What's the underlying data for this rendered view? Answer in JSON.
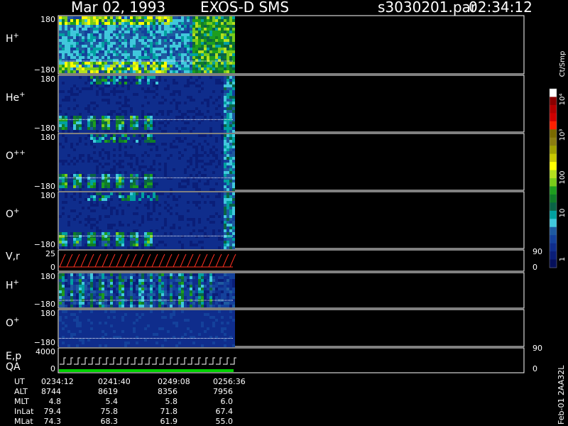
{
  "header": {
    "date": "Mar 02, 1993",
    "instrument": "EXOS-D SMS",
    "file": "s3030201.par",
    "time": "02:34:12"
  },
  "colorbar": {
    "unit": "Ct/Smp",
    "ticks": [
      "10⁴",
      "10³",
      "100",
      "10",
      "1"
    ],
    "colors": [
      "#ffffff",
      "#8b0000",
      "#b40000",
      "#d10000",
      "#ff2000",
      "#7a6a00",
      "#8b7d10",
      "#a0a000",
      "#c8c800",
      "#ffff00",
      "#b4e01e",
      "#7acc19",
      "#1e9e1e",
      "#0f7d28",
      "#0a6446",
      "#00a0a0",
      "#40c8dc",
      "#1e5aa0",
      "#14419b",
      "#0f2d8c",
      "#0a1e78",
      "#050f5a"
    ]
  },
  "panels": [
    {
      "id": "h-plus",
      "label": "H",
      "sup": "+",
      "ymax": "180",
      "ymin": "−180"
    },
    {
      "id": "he-plus",
      "label": "He",
      "sup": "+",
      "ymax": "180",
      "ymin": "−180"
    },
    {
      "id": "o-plusplus",
      "label": "O",
      "sup": "++",
      "ymax": "180",
      "ymin": "−180"
    },
    {
      "id": "o-plus",
      "label": "O",
      "sup": "+",
      "ymax": "180",
      "ymin": "−180"
    },
    {
      "id": "vr",
      "label": "V,r",
      "sup": "",
      "ymax": "25",
      "ymin": "0",
      "rmax": "90",
      "rmin": "0"
    },
    {
      "id": "h-plus-2",
      "label": "H",
      "sup": "+",
      "ymax": "180",
      "ymin": "−180"
    },
    {
      "id": "o-plus-2",
      "label": "O",
      "sup": "+",
      "ymax": "180",
      "ymin": "−180"
    },
    {
      "id": "ep-qa",
      "label": "E,p",
      "label2": "QA",
      "sup": "",
      "ymax": "4000",
      "ymin": "0",
      "rmax": "90",
      "rmin": "0"
    }
  ],
  "footer": {
    "rows": [
      {
        "label": "UT",
        "values": [
          "0234:12",
          "0241:40",
          "0249:08",
          "0256:36"
        ]
      },
      {
        "label": "ALT",
        "values": [
          "8744",
          "8619",
          "8356",
          "7956"
        ]
      },
      {
        "label": "MLT",
        "values": [
          "4.8",
          "5.4",
          "5.8",
          "6.0"
        ]
      },
      {
        "label": "InLat",
        "values": [
          "79.4",
          "75.8",
          "71.8",
          "67.4"
        ]
      },
      {
        "label": "MLat",
        "values": [
          "74.3",
          "68.3",
          "61.9",
          "55.0"
        ]
      }
    ],
    "side_note": "Feb-01  2AA32L"
  },
  "chart_data": {
    "type": "heatmap",
    "title": "Mar 02, 1993   EXOS-D SMS",
    "xlabel": "UT",
    "x_ticks": [
      "0234:12",
      "0241:40",
      "0249:08",
      "0256:36"
    ],
    "colorbar_label": "Ct/Smp",
    "colorbar_scale": "log",
    "colorbar_range": [
      1,
      10000
    ],
    "series": [
      {
        "name": "H+",
        "ylim": [
          -180,
          180
        ]
      },
      {
        "name": "He+",
        "ylim": [
          -180,
          180
        ]
      },
      {
        "name": "O++",
        "ylim": [
          -180,
          180
        ]
      },
      {
        "name": "O+",
        "ylim": [
          -180,
          180
        ]
      },
      {
        "name": "V,r",
        "ylim": [
          0,
          25
        ],
        "y2lim": [
          0,
          90
        ]
      },
      {
        "name": "H+",
        "ylim": [
          -180,
          180
        ]
      },
      {
        "name": "O+",
        "ylim": [
          -180,
          180
        ]
      },
      {
        "name": "E,p / QA",
        "ylim": [
          0,
          4000
        ],
        "y2lim": [
          0,
          90
        ]
      }
    ],
    "grid": false
  }
}
